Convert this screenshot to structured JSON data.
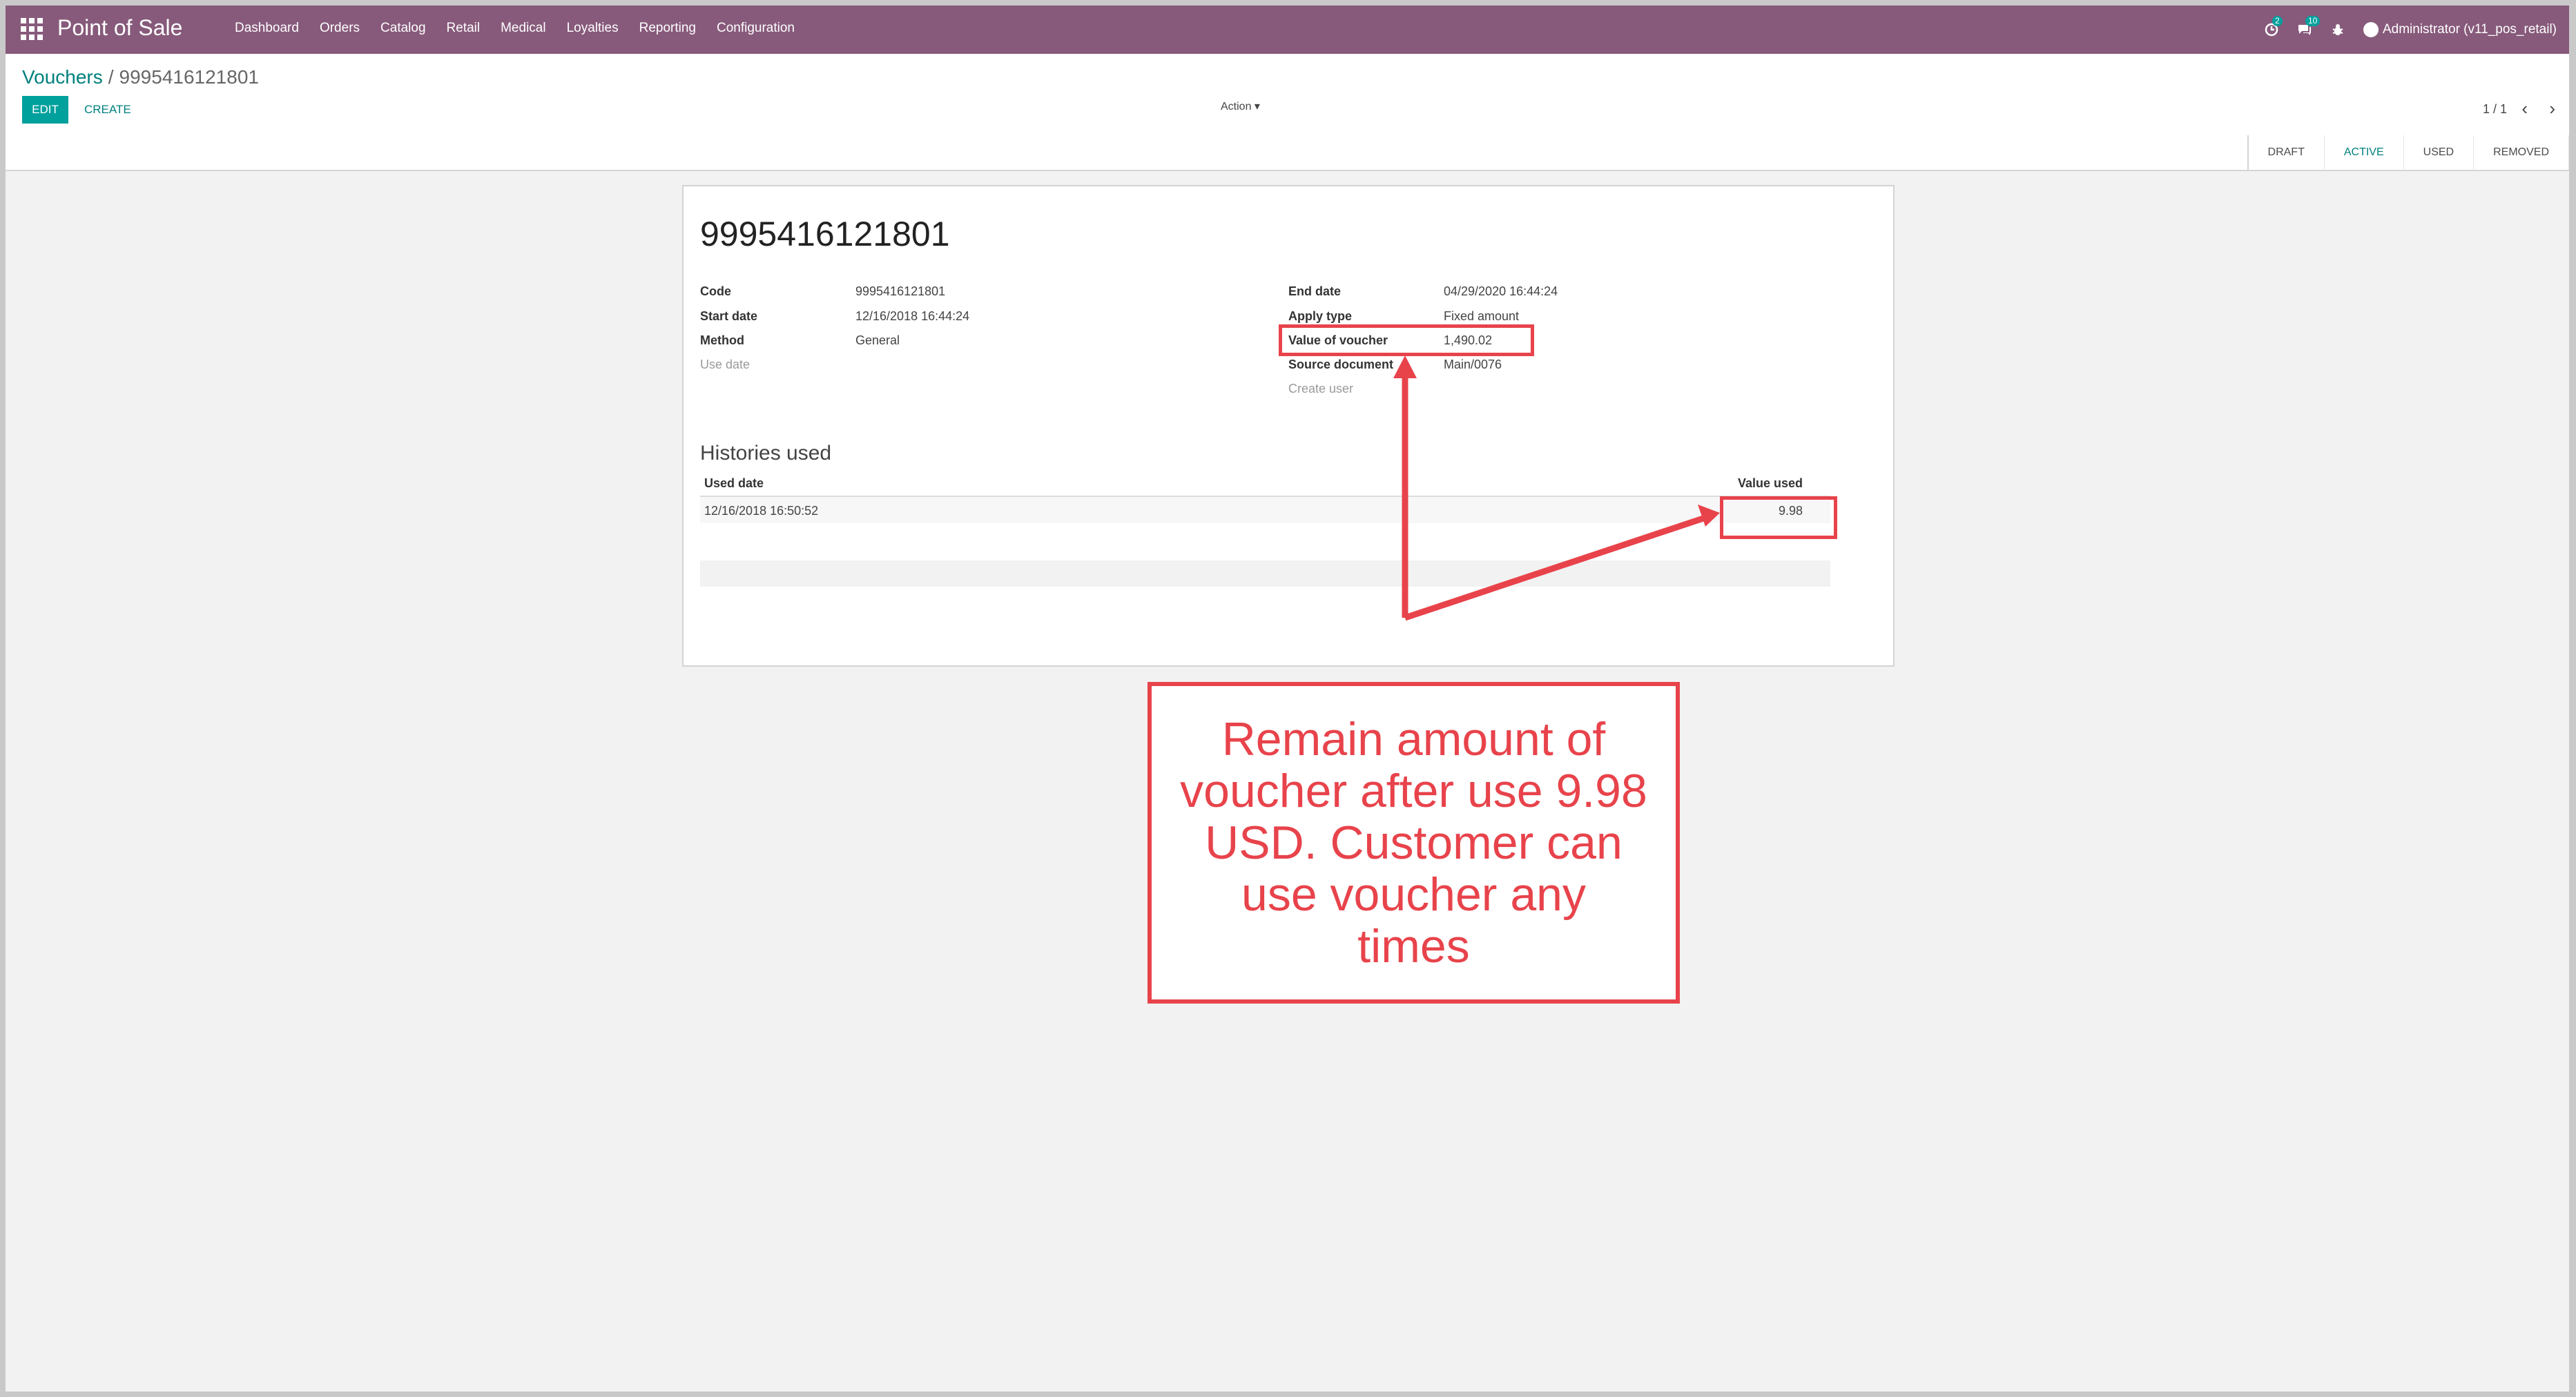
{
  "navbar": {
    "app_title": "Point of Sale",
    "menu": [
      "Dashboard",
      "Orders",
      "Catalog",
      "Retail",
      "Medical",
      "Loyalties",
      "Reporting",
      "Configuration"
    ],
    "activity_count": "2",
    "messages_count": "10",
    "user": "Administrator (v11_pos_retail)"
  },
  "control_panel": {
    "breadcrumb_parent": "Vouchers",
    "breadcrumb_separator": "/",
    "breadcrumb_current": "9995416121801",
    "edit_label": "EDIT",
    "create_label": "CREATE",
    "action_label": "Action",
    "pager": "1 / 1"
  },
  "status": {
    "stages": [
      "DRAFT",
      "ACTIVE",
      "USED",
      "REMOVED"
    ],
    "active_stage": "ACTIVE"
  },
  "form": {
    "title": "9995416121801",
    "left": [
      {
        "label": "Code",
        "value": "9995416121801"
      },
      {
        "label": "Start date",
        "value": "12/16/2018 16:44:24"
      },
      {
        "label": "Method",
        "value": "General"
      },
      {
        "label": "Use date",
        "value": ""
      }
    ],
    "right": [
      {
        "label": "End date",
        "value": "04/29/2020 16:44:24"
      },
      {
        "label": "Apply type",
        "value": "Fixed amount"
      },
      {
        "label": "Value of voucher",
        "value": "1,490.02"
      },
      {
        "label": "Source document",
        "value": "Main/0076"
      },
      {
        "label": "Create user",
        "value": ""
      }
    ],
    "histories_title": "Histories used",
    "table": {
      "columns": [
        "Used date",
        "Value used"
      ],
      "rows": [
        [
          "12/16/2018 16:50:52",
          "9.98"
        ]
      ]
    }
  },
  "annotation": {
    "text": "Remain amount of voucher after use 9.98 USD. Customer can use voucher any times",
    "color": "#e8434b"
  },
  "colors": {
    "navbar": "#875a7b",
    "primary": "#00a09d",
    "link": "#00807d"
  }
}
